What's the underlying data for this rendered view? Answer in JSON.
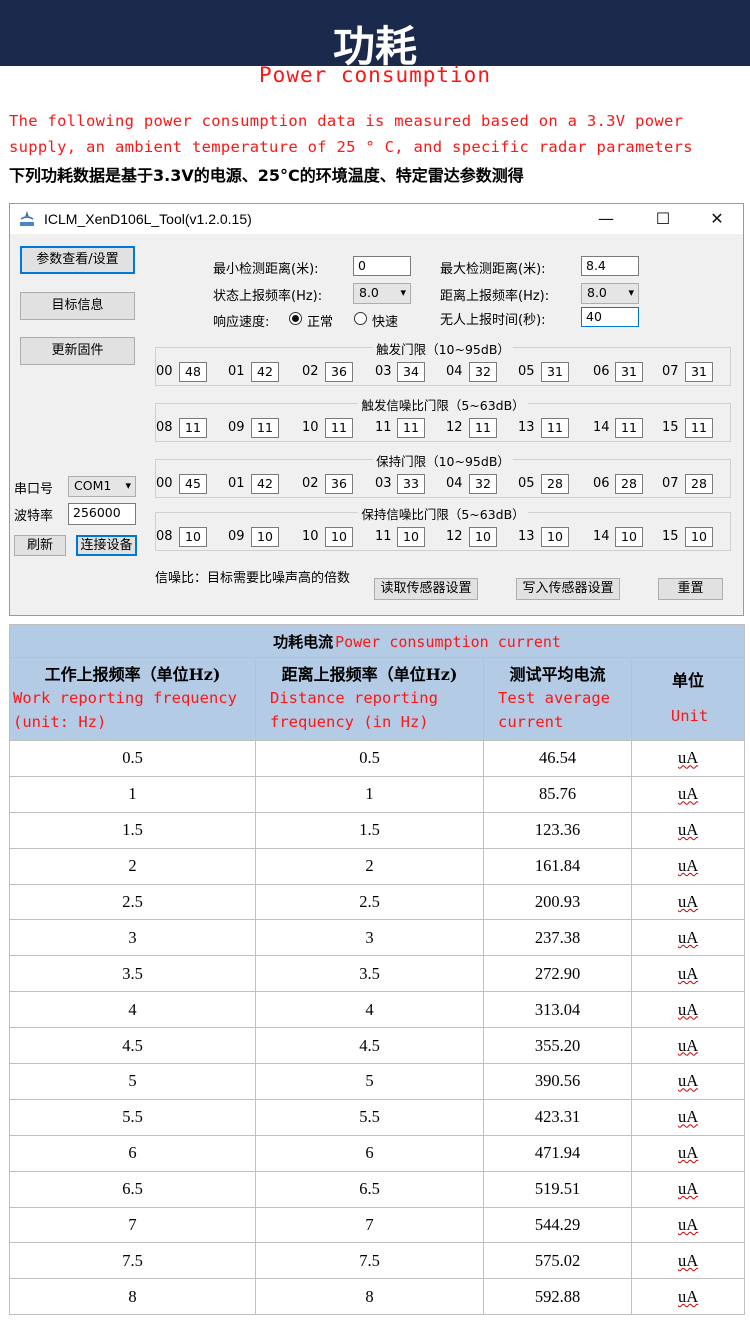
{
  "banner": {
    "title": "功耗",
    "subtitle": "Power consumption"
  },
  "intro": {
    "english": "The following power consumption data is measured based on a 3.3V power supply, an ambient temperature of 25 ° C, and specific radar parameters",
    "chinese": "下列功耗数据是基于3.3V的电源、25°C的环境温度、特定雷达参数测得"
  },
  "window": {
    "title": "ICLM_XenD106L_Tool(v1.2.0.15)",
    "controls": {
      "minimize": "—",
      "maximize": "☐",
      "close": "✕"
    },
    "nav": {
      "params": "参数查看/设置",
      "target": "目标信息",
      "firmware": "更新固件"
    },
    "serial": {
      "port_label": "串口号",
      "port_value": "COM1",
      "baud_label": "波特率",
      "baud_value": "256000",
      "refresh": "刷新",
      "connect": "连接设备"
    },
    "settings": {
      "min_dist_label": "最小检测距离(米):",
      "min_dist_value": "0",
      "max_dist_label": "最大检测距离(米):",
      "max_dist_value": "8.4",
      "state_freq_label": "状态上报频率(Hz):",
      "state_freq_value": "8.0",
      "dist_freq_label": "距离上报频率(Hz):",
      "dist_freq_value": "8.0",
      "response_label": "响应速度:",
      "response_normal": "正常",
      "response_fast": "快速",
      "no_person_label": "无人上报时间(秒):",
      "no_person_value": "40"
    },
    "groups": [
      {
        "title": "触发门限（10~95dB）",
        "indices": [
          "00",
          "01",
          "02",
          "03",
          "04",
          "05",
          "06",
          "07"
        ],
        "values": [
          "48",
          "42",
          "36",
          "34",
          "32",
          "31",
          "31",
          "31"
        ]
      },
      {
        "title": "触发信噪比门限（5~63dB）",
        "indices": [
          "08",
          "09",
          "10",
          "11",
          "12",
          "13",
          "14",
          "15"
        ],
        "values": [
          "11",
          "11",
          "11",
          "11",
          "11",
          "11",
          "11",
          "11"
        ]
      },
      {
        "title": "保持门限（10~95dB）",
        "indices": [
          "00",
          "01",
          "02",
          "03",
          "04",
          "05",
          "06",
          "07"
        ],
        "values": [
          "45",
          "42",
          "36",
          "33",
          "32",
          "28",
          "28",
          "28"
        ]
      },
      {
        "title": "保持信噪比门限（5~63dB）",
        "indices": [
          "08",
          "09",
          "10",
          "11",
          "12",
          "13",
          "14",
          "15"
        ],
        "values": [
          "10",
          "10",
          "10",
          "10",
          "10",
          "10",
          "10",
          "10"
        ]
      }
    ],
    "footer": {
      "note": "信噪比：目标需要比噪声高的倍数",
      "read": "读取传感器设置",
      "write": "写入传感器设置",
      "reset": "重置"
    }
  },
  "table": {
    "caption_cn": "功耗电流",
    "caption_en": "Power consumption current",
    "headers": [
      {
        "cn": "工作上报频率（单位Hz)",
        "en": [
          "Work reporting frequency",
          "(unit: Hz)"
        ]
      },
      {
        "cn": "距离上报频率（单位Hz)",
        "en": [
          "Distance reporting",
          "frequency (in Hz)"
        ]
      },
      {
        "cn": "测试平均电流",
        "en": [
          "Test average",
          "current"
        ]
      },
      {
        "cn": "单位",
        "en": [
          "Unit"
        ]
      }
    ],
    "rows": [
      [
        "0.5",
        "0.5",
        "46.54",
        "uA"
      ],
      [
        "1",
        "1",
        "85.76",
        "uA"
      ],
      [
        "1.5",
        "1.5",
        "123.36",
        "uA"
      ],
      [
        "2",
        "2",
        "161.84",
        "uA"
      ],
      [
        "2.5",
        "2.5",
        "200.93",
        "uA"
      ],
      [
        "3",
        "3",
        "237.38",
        "uA"
      ],
      [
        "3.5",
        "3.5",
        "272.90",
        "uA"
      ],
      [
        "4",
        "4",
        "313.04",
        "uA"
      ],
      [
        "4.5",
        "4.5",
        "355.20",
        "uA"
      ],
      [
        "5",
        "5",
        "390.56",
        "uA"
      ],
      [
        "5.5",
        "5.5",
        "423.31",
        "uA"
      ],
      [
        "6",
        "6",
        "471.94",
        "uA"
      ],
      [
        "6.5",
        "6.5",
        "519.51",
        "uA"
      ],
      [
        "7",
        "7",
        "544.29",
        "uA"
      ],
      [
        "7.5",
        "7.5",
        "575.02",
        "uA"
      ],
      [
        "8",
        "8",
        "592.88",
        "uA"
      ]
    ]
  }
}
